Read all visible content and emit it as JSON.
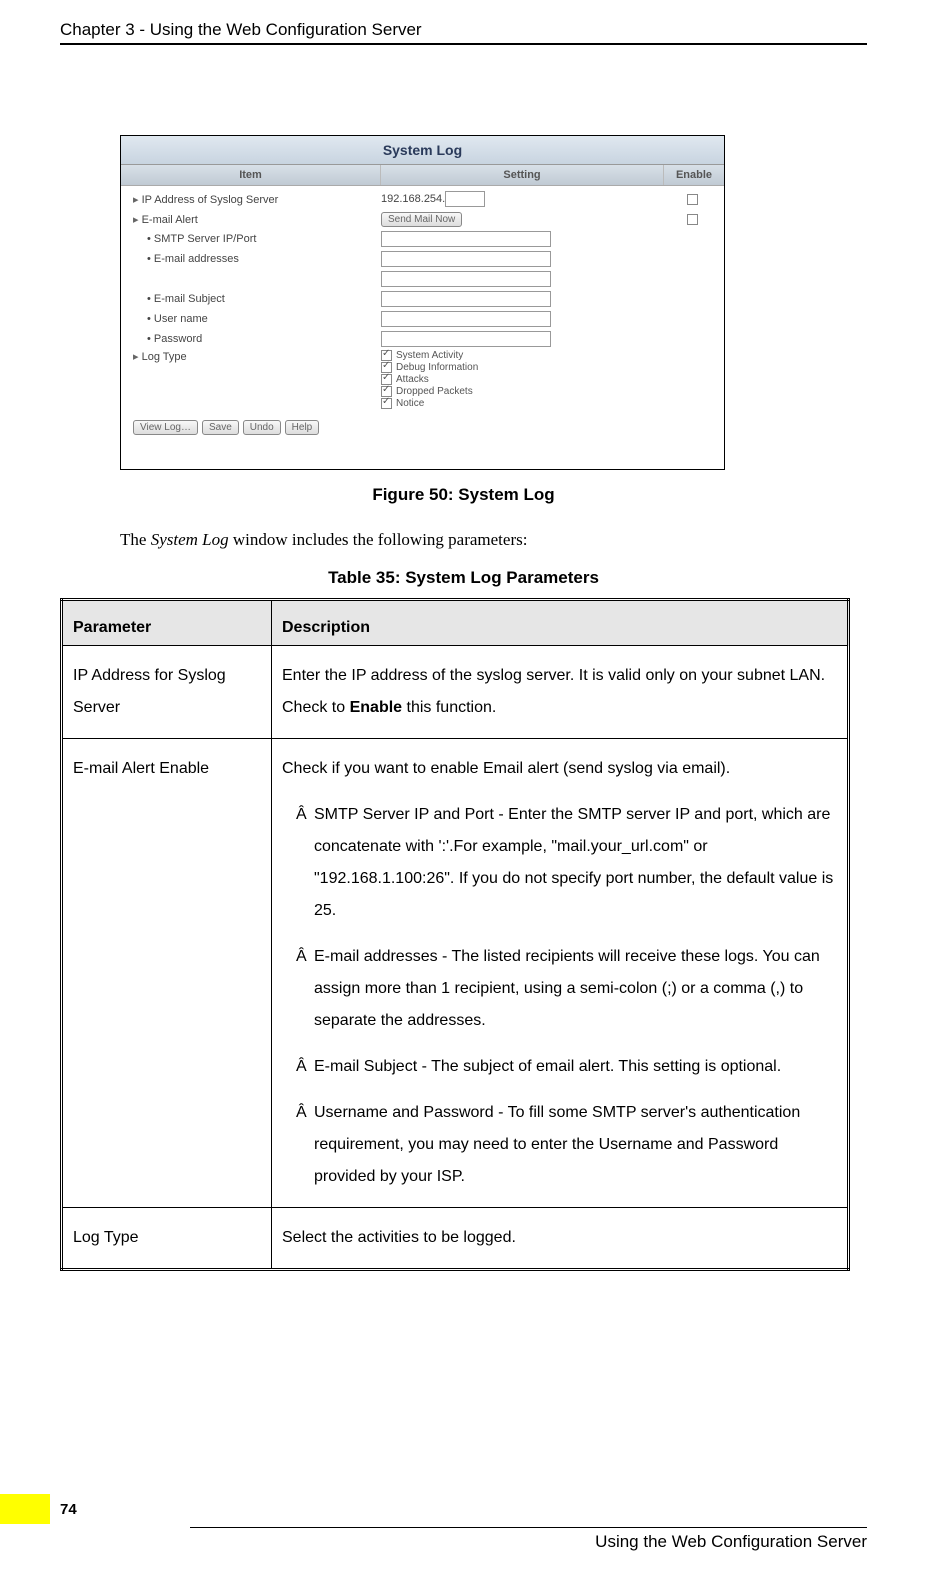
{
  "chapter_header": "Chapter 3 - Using the Web Configuration Server",
  "screenshot": {
    "title": "System Log",
    "headers": {
      "item": "Item",
      "setting": "Setting",
      "enable": "Enable"
    },
    "rows": {
      "syslog_ip": {
        "label": "IP Address of Syslog Server",
        "prefix": "192.168.254."
      },
      "email_alert": {
        "label": "E-mail Alert",
        "button": "Send Mail Now"
      },
      "smtp": {
        "label": "SMTP Server IP/Port"
      },
      "addresses": {
        "label": "E-mail addresses"
      },
      "subject": {
        "label": "E-mail Subject"
      },
      "username": {
        "label": "User name"
      },
      "password": {
        "label": "Password"
      },
      "logtype": {
        "label": "Log Type"
      }
    },
    "log_types": [
      "System Activity",
      "Debug Information",
      "Attacks",
      "Dropped Packets",
      "Notice"
    ],
    "buttons": [
      "View Log…",
      "Save",
      "Undo",
      "Help"
    ]
  },
  "figure_caption": "Figure 50: System Log",
  "intro_text_prefix": "The ",
  "intro_text_italic": "System Log",
  "intro_text_suffix": " window includes the following parameters:",
  "table_caption": "Table 35: System Log Parameters",
  "param_table": {
    "headers": {
      "parameter": "Parameter",
      "description": "Description"
    },
    "rows": [
      {
        "param": "IP Address for Syslog Server",
        "desc_plain_1": "Enter the IP address of the syslog server. It is valid only on your subnet LAN. Check to ",
        "desc_bold": "Enable",
        "desc_plain_2": " this function."
      },
      {
        "param": "E-mail Alert Enable",
        "desc_intro": "Check if you want to enable Email alert (send syslog via email).",
        "items": [
          "SMTP Server IP and Port - Enter the SMTP server IP and port, which are concatenate with ':'.For example, \"mail.your_url.com\" or \"192.168.1.100:26\". If you do not specify port number, the default value is 25.",
          "E-mail addresses - The listed recipients will receive these logs. You can assign more than 1 recipient, using a semi-colon (;) or a comma (,) to separate the addresses.",
          "E-mail Subject - The subject of email alert. This setting is optional.",
          "Username and Password - To fill some SMTP server's authentication requirement, you may need to enter the Username and Password provided by your ISP."
        ]
      },
      {
        "param": "Log Type",
        "desc_plain": "Select the activities to be logged."
      }
    ]
  },
  "list_marker": "Â",
  "footer_text": "Using the Web Configuration Server",
  "page_number": "74"
}
